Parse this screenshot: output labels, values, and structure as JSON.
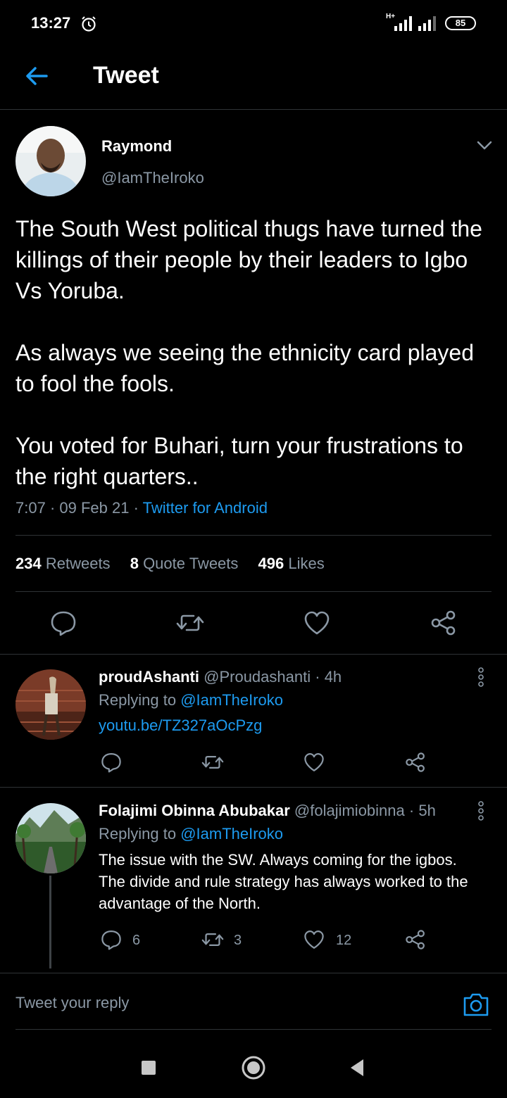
{
  "status_bar": {
    "time": "13:27",
    "network": "H+",
    "battery": "85"
  },
  "header": {
    "title": "Tweet"
  },
  "main_tweet": {
    "name": "Raymond",
    "handle": "@IamTheIroko",
    "paragraphs": [
      "The South West political thugs have turned the killings of their people by their leaders to Igbo Vs Yoruba.",
      "As always we seeing the ethnicity card played to fool the fools.",
      "You voted for Buhari, turn your frustrations to the right quarters.."
    ],
    "time": "7:07",
    "date": "09 Feb 21",
    "source": "Twitter for Android",
    "retweets_count": "234",
    "retweets_label": "Retweets",
    "quotes_count": "8",
    "quotes_label": "Quote Tweets",
    "likes_count": "496",
    "likes_label": "Likes"
  },
  "replies": [
    {
      "name": "proudAshanti",
      "handle": "@Proudashanti",
      "age": "4h",
      "replying_prefix": "Replying to",
      "replying_to": "@IamTheIroko",
      "link": "youtu.be/TZ327aOcPzg"
    },
    {
      "name": "Folajimi Obinna Abubakar",
      "handle": "@folajimiobinna",
      "age": "5h",
      "replying_prefix": "Replying to",
      "replying_to": "@IamTheIroko",
      "lines": [
        "The issue with the SW. Always coming for the igbos.",
        "The divide and rule strategy has always worked to the",
        "advantage of the North."
      ],
      "reply_count": "6",
      "retweet_count": "3",
      "like_count": "12"
    }
  ],
  "reply_bar": {
    "placeholder": "Tweet your reply"
  },
  "colors": {
    "accent": "#1d9bf0",
    "background": "#000000",
    "muted": "#8b98a5",
    "divider": "#2f3336"
  }
}
